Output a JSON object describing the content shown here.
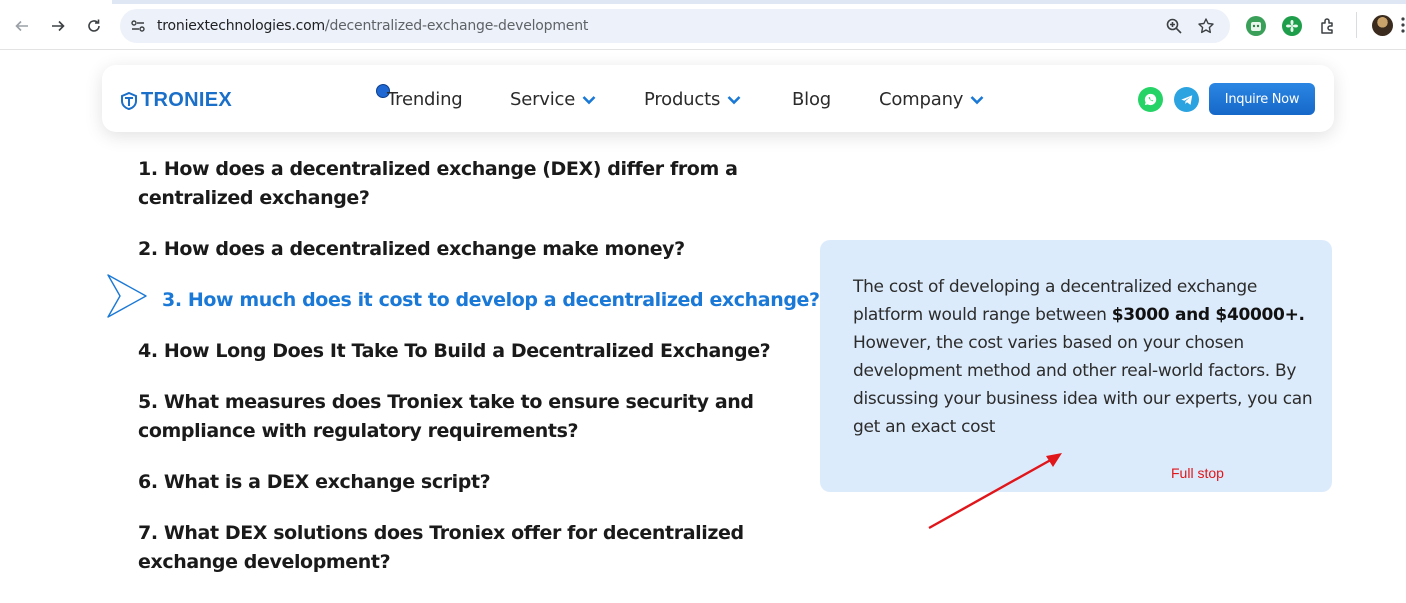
{
  "browser": {
    "url_host": "troniextechnologies.com",
    "url_path": "/decentralized-exchange-development"
  },
  "header": {
    "logo_text": "TRONIEX",
    "nav": [
      {
        "label": "Trending",
        "has_dropdown": false
      },
      {
        "label": "Service",
        "has_dropdown": true
      },
      {
        "label": "Products",
        "has_dropdown": true
      },
      {
        "label": "Blog",
        "has_dropdown": false
      },
      {
        "label": "Company",
        "has_dropdown": true
      }
    ],
    "inquire_label": "Inquire Now"
  },
  "faq": {
    "items": [
      "1. How does a decentralized exchange (DEX) differ from a centralized exchange?",
      "2. How does a decentralized exchange make money?",
      "3. How much does it cost to develop a decentralized exchange?",
      "4. How Long Does It Take To Build a Decentralized Exchange?",
      "5. What measures does Troniex take to ensure security and compliance with regulatory requirements?",
      "6. What is a DEX exchange script?",
      "7. What DEX solutions does Troniex offer for decentralized exchange development?"
    ],
    "active_index": 2
  },
  "answer": {
    "text_before": "The cost of developing a decentralized exchange platform would range between ",
    "text_bold": "$3000 and $40000+.",
    "text_after": " However, the cost varies based on your chosen development method and other real-world factors. By discussing your business idea with our experts, you can get an exact cost"
  },
  "annotation": {
    "label": "Full stop"
  },
  "colors": {
    "accent": "#1a78d6",
    "card_bg": "#dcebfb",
    "annotation": "#e0161b"
  }
}
